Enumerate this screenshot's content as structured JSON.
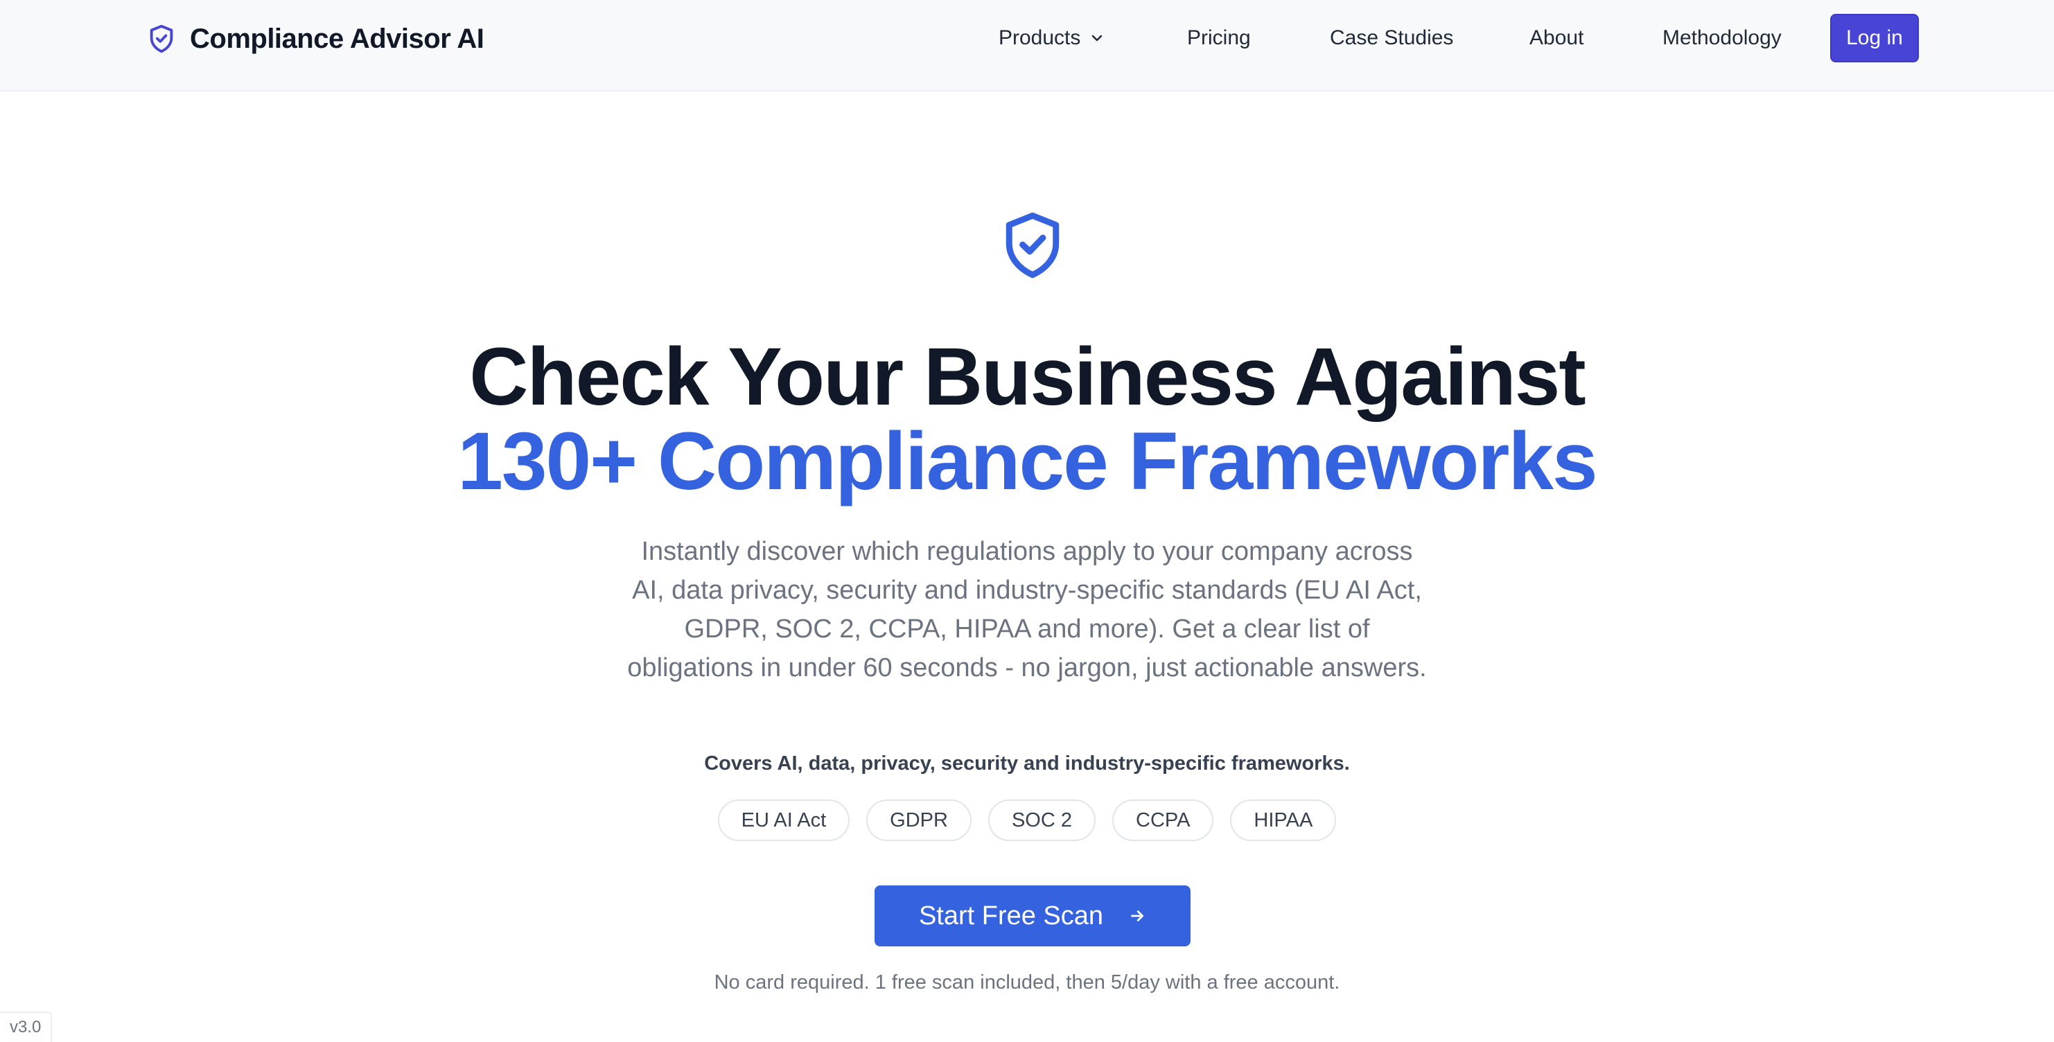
{
  "nav": {
    "brand": "Compliance Advisor AI",
    "links": [
      "Products",
      "Pricing",
      "Case Studies",
      "About",
      "Methodology"
    ],
    "login": "Log in"
  },
  "hero": {
    "headline_line1": "Check Your Business Against",
    "headline_line2": "130+ Compliance Frameworks",
    "description": "Instantly discover which regulations apply to your company across AI, data privacy, security and industry-specific standards (EU AI Act, GDPR, SOC 2, CCPA, HIPAA and more). Get a clear list of obligations in under 60 seconds - no jargon, just actionable answers.",
    "covers": "Covers AI, data, privacy, security and industry-specific frameworks.",
    "tags": [
      "EU AI Act",
      "GDPR",
      "SOC 2",
      "CCPA",
      "HIPAA"
    ],
    "cta": "Start Free Scan",
    "note": "No card required. 1 free scan included, then 5/day with a free account."
  },
  "version": "v3.0",
  "icons": {
    "brand": "shield-check-icon",
    "hero": "shield-check-icon",
    "products_dropdown": "chevron-down-icon",
    "cta": "arrow-right-icon"
  },
  "colors": {
    "primary": "#3563e0",
    "login_button": "#4744d6",
    "brand_icon": "#4744d6",
    "heading": "#111827",
    "muted_text": "#6b7280",
    "nav_background": "#f8f9fb"
  }
}
